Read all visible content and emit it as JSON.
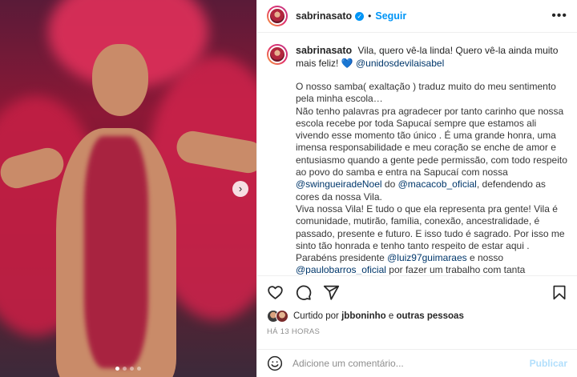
{
  "post": {
    "username": "sabrinasato",
    "follow_label": "Seguir",
    "separator": "•",
    "more_glyph": "•••"
  },
  "caption": {
    "username": "sabrinasato",
    "text": "Vila, quero vê-la linda! Quero vê-la ainda muito mais feliz!",
    "heart": "💙",
    "mention": "@unidosdevilaisabel"
  },
  "body": {
    "p1": "O nosso samba( exaltação ) traduz muito do meu sentimento pela minha escola…",
    "p2_a": "Não tenho palavras pra agradecer por tanto carinho que nossa escola recebe por toda Sapucaí sempre que estamos ali vivendo esse momento tão único . É uma grande honra, uma imensa responsabilidade e meu coração se enche de amor e entusiasmo quando a gente pede permissão, com todo respeito ao povo do samba e entra na Sapucaí com nossa",
    "p2_mention1": "@swingueiradeNoel",
    "p2_b": "do",
    "p2_mention2": "@macacob_oficial",
    "p2_c": ", defendendo as cores da nossa Vila.",
    "p3_a": "Viva nossa Vila! E tudo o que ela representa pra gente! Vila é comunidade, mutirão, família, conexão, ancestralidade, é passado, presente e futuro. E isso tudo é sagrado. Por isso me sinto tão honrada e tenho tanto respeito de estar aqui . Parabéns presidente",
    "p3_mention1": "@luiz97guimaraes",
    "p3_b": "e nosso",
    "p3_mention2": "@paulobarros_oficial",
    "p3_c": "por fazer um trabalho com tanta excelência. Parabéns à todos os segmentos da nossa escola, todos que trabalharam muito para"
  },
  "likes": {
    "prefix": "Curtido por",
    "user": "jbboninho",
    "middle": "e",
    "others": "outras pessoas"
  },
  "timestamp": "HÁ 13 HORAS",
  "comment": {
    "placeholder": "Adicione um comentário...",
    "publish_label": "Publicar"
  },
  "icons": {
    "like": "heart-icon",
    "comment": "comment-icon",
    "share": "share-icon",
    "save": "bookmark-icon",
    "emoji": "emoji-icon",
    "next": "chevron-right-icon"
  },
  "colors": {
    "accent": "#0095f6",
    "mention": "#00376b",
    "publish_disabled": "#b2dffc",
    "timestamp": "#8e8e8e"
  },
  "carousel": {
    "next_glyph": "›",
    "slide_count": 4,
    "active_slide": 1
  }
}
